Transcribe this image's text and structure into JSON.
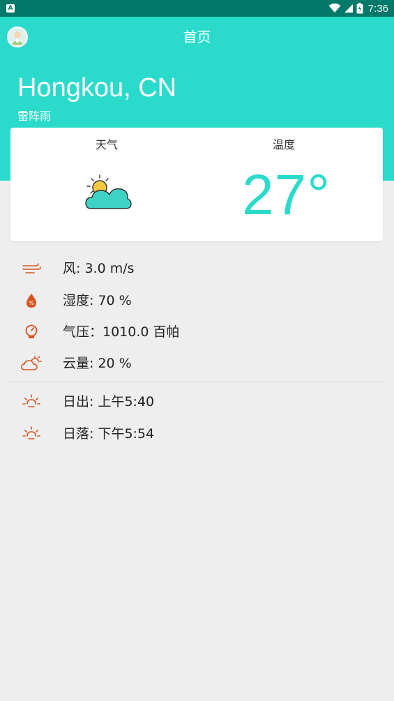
{
  "status_bar": {
    "left_icon": "A",
    "time": "7:36",
    "icons": [
      "wifi-icon",
      "signal-icon",
      "battery-icon"
    ]
  },
  "header": {
    "title": "首页",
    "city": "Hongkou, CN",
    "condition": "雷阵雨"
  },
  "card": {
    "weather_label": "天气",
    "temp_label": "温度",
    "weather_icon": "partly-cloudy-icon",
    "temperature": "27°"
  },
  "details": {
    "wind": "风: 3.0 m/s",
    "humidity": "湿度: 70  %",
    "pressure": "气压：1010.0 百帕",
    "cloudiness": "云量: 20 %",
    "sunrise": "日出: 上午5:40",
    "sunset": "日落: 下午5:54"
  },
  "colors": {
    "accent": "#2adbcb",
    "status_bar": "#00796b",
    "icon_orange": "#d9531e",
    "background": "#eeeeee"
  }
}
